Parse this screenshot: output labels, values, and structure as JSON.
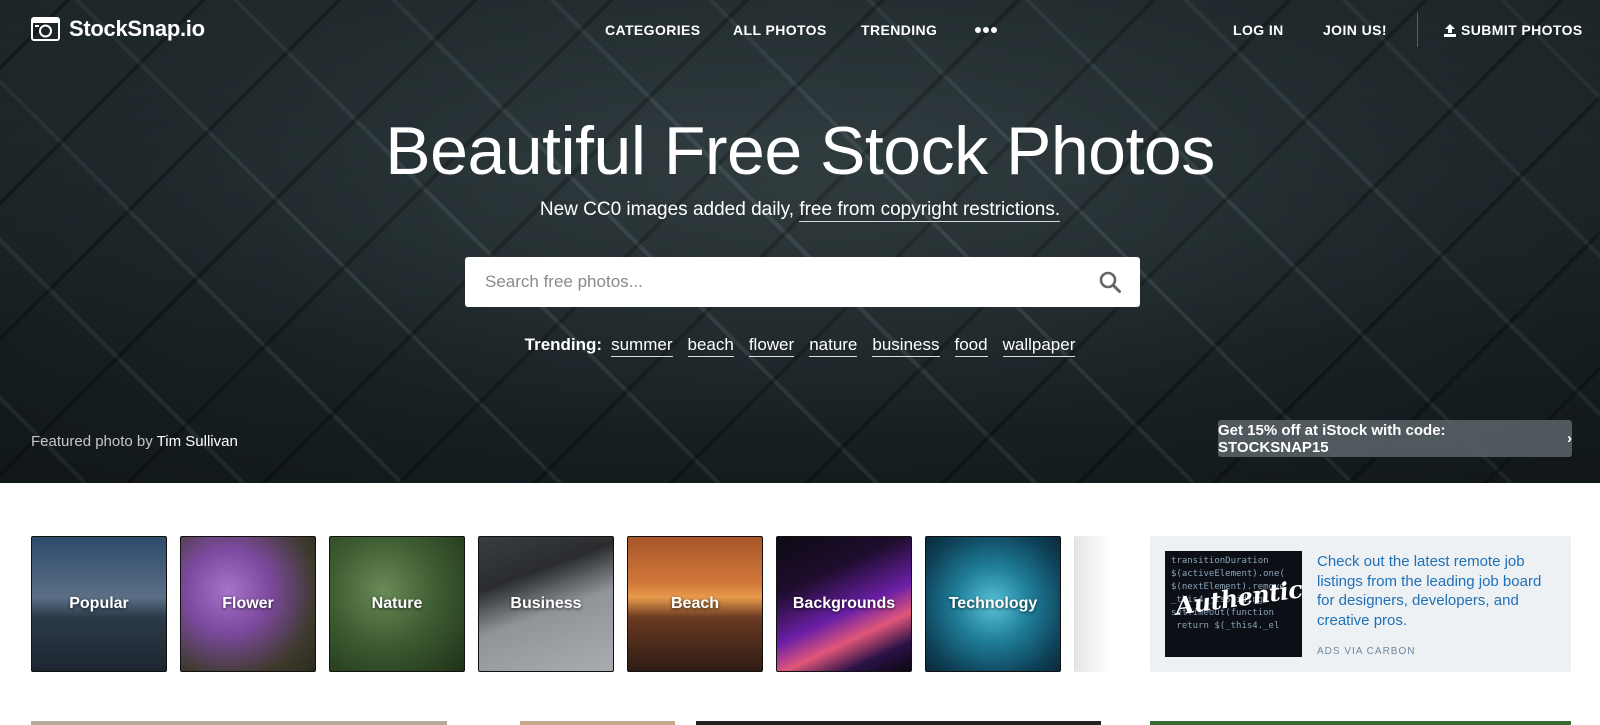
{
  "nav": {
    "logo_text": "StockSnap.io",
    "links": [
      "CATEGORIES",
      "ALL PHOTOS",
      "TRENDING"
    ],
    "more_icon": "more-dots-icon",
    "login": "LOG IN",
    "join": "JOIN US!",
    "submit": "SUBMIT PHOTOS"
  },
  "hero": {
    "title": "Beautiful Free Stock Photos",
    "subtitle_prefix": "New CC0 images added daily,",
    "subtitle_link": "free from copyright restrictions.",
    "search_placeholder": "Search free photos...",
    "trending_label": "Trending:",
    "trending_tags": [
      "summer",
      "beach",
      "flower",
      "nature",
      "business",
      "food",
      "wallpaper"
    ],
    "credit_prefix": "Featured photo by",
    "credit_author": "Tim Sullivan",
    "promo_text": "Get 15% off at iStock with code: STOCKSNAP15"
  },
  "categories": [
    {
      "label": "Popular"
    },
    {
      "label": "Flower"
    },
    {
      "label": "Nature"
    },
    {
      "label": "Business"
    },
    {
      "label": "Beach"
    },
    {
      "label": "Backgrounds"
    },
    {
      "label": "Technology"
    }
  ],
  "ad": {
    "text": "Check out the latest remote job listings from the leading job board for designers, developers, and creative pros.",
    "via": "ADS VIA CARBON",
    "image_brand": "Authentic"
  },
  "colors": {
    "accent_link": "#1f70b8",
    "hero_bg": "#1f2a2e",
    "ad_bg": "#eef1f4"
  }
}
